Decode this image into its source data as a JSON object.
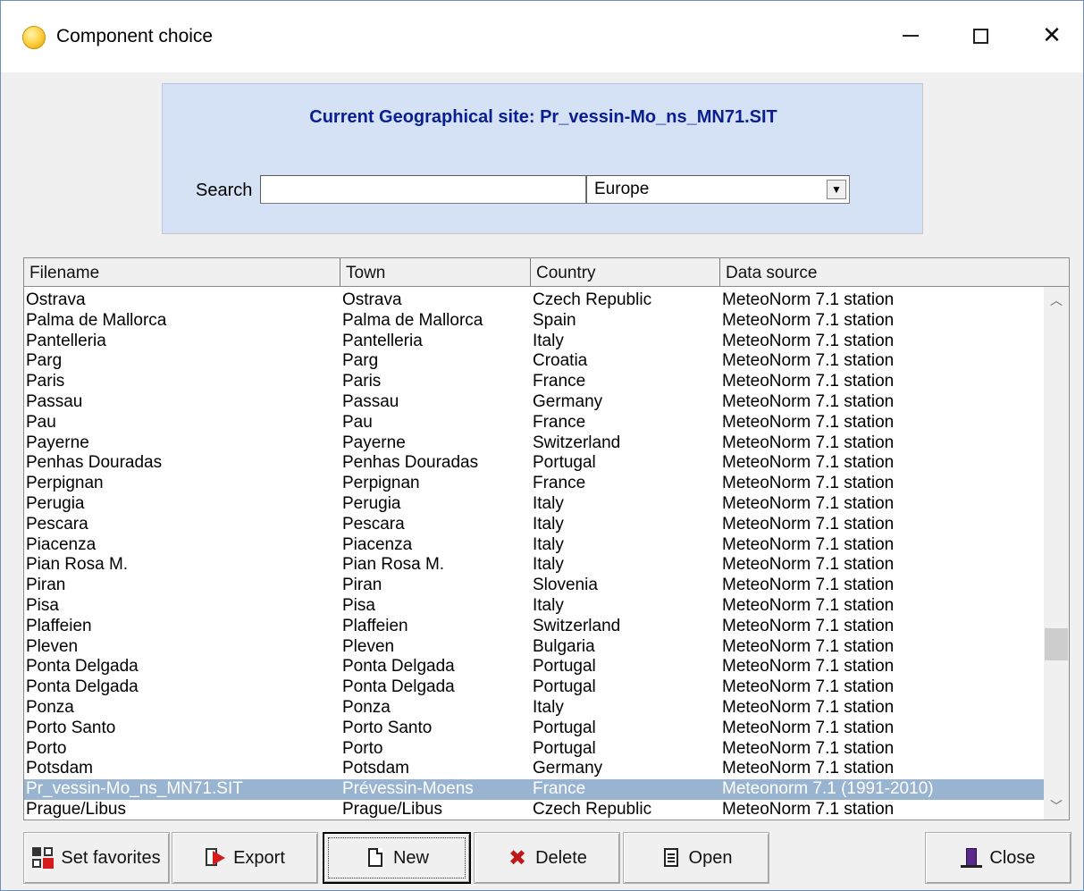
{
  "window": {
    "title": "Component choice",
    "controls": [
      "minimize",
      "maximize",
      "close"
    ]
  },
  "site": {
    "current_label": "Current Geographical site: Pr_vessin-Mo_ns_MN71.SIT",
    "search_label": "Search",
    "search_value": "",
    "region_selected": "Europe"
  },
  "list": {
    "columns": [
      "Filename",
      "Town",
      "Country",
      "Data source"
    ],
    "rows": [
      [
        "Ostrava",
        "Ostrava",
        "Czech Republic",
        "MeteoNorm 7.1 station"
      ],
      [
        "Palma de Mallorca",
        "Palma de Mallorca",
        "Spain",
        "MeteoNorm 7.1 station"
      ],
      [
        "Pantelleria",
        "Pantelleria",
        "Italy",
        "MeteoNorm 7.1 station"
      ],
      [
        "Parg",
        "Parg",
        "Croatia",
        "MeteoNorm 7.1 station"
      ],
      [
        "Paris",
        "Paris",
        "France",
        "MeteoNorm 7.1 station"
      ],
      [
        "Passau",
        "Passau",
        "Germany",
        "MeteoNorm 7.1 station"
      ],
      [
        "Pau",
        "Pau",
        "France",
        "MeteoNorm 7.1 station"
      ],
      [
        "Payerne",
        "Payerne",
        "Switzerland",
        "MeteoNorm 7.1 station"
      ],
      [
        "Penhas Douradas",
        "Penhas Douradas",
        "Portugal",
        "MeteoNorm 7.1 station"
      ],
      [
        "Perpignan",
        "Perpignan",
        "France",
        "MeteoNorm 7.1 station"
      ],
      [
        "Perugia",
        "Perugia",
        "Italy",
        "MeteoNorm 7.1 station"
      ],
      [
        "Pescara",
        "Pescara",
        "Italy",
        "MeteoNorm 7.1 station"
      ],
      [
        "Piacenza",
        "Piacenza",
        "Italy",
        "MeteoNorm 7.1 station"
      ],
      [
        "Pian Rosa M.",
        "Pian Rosa M.",
        "Italy",
        "MeteoNorm 7.1 station"
      ],
      [
        "Piran",
        "Piran",
        "Slovenia",
        "MeteoNorm 7.1 station"
      ],
      [
        "Pisa",
        "Pisa",
        "Italy",
        "MeteoNorm 7.1 station"
      ],
      [
        "Plaffeien",
        "Plaffeien",
        "Switzerland",
        "MeteoNorm 7.1 station"
      ],
      [
        "Pleven",
        "Pleven",
        "Bulgaria",
        "MeteoNorm 7.1 station"
      ],
      [
        "Ponta Delgada",
        "Ponta Delgada",
        "Portugal",
        "MeteoNorm 7.1 station"
      ],
      [
        "Ponta Delgada",
        "Ponta Delgada",
        "Portugal",
        "MeteoNorm 7.1 station"
      ],
      [
        "Ponza",
        "Ponza",
        "Italy",
        "MeteoNorm 7.1 station"
      ],
      [
        "Porto Santo",
        "Porto Santo",
        "Portugal",
        "MeteoNorm 7.1 station"
      ],
      [
        "Porto",
        "Porto",
        "Portugal",
        "MeteoNorm 7.1 station"
      ],
      [
        "Potsdam",
        "Potsdam",
        "Germany",
        "MeteoNorm 7.1 station"
      ],
      [
        "Pr_vessin-Mo_ns_MN71.SIT",
        "Prévessin-Moens",
        "France",
        "Meteonorm 7.1 (1991-2010)"
      ],
      [
        "Prague/Libus",
        "Prague/Libus",
        "Czech Republic",
        "MeteoNorm 7.1 station"
      ]
    ],
    "selected_row": 24
  },
  "buttons": {
    "set_favorites": "Set favorites",
    "export": "Export",
    "new": "New",
    "delete": "Delete",
    "open": "Open",
    "close": "Close"
  },
  "colors": {
    "panel_bg": "#d5e1f5",
    "site_title": "#0a1f8f",
    "selection": "#99b4d1"
  }
}
